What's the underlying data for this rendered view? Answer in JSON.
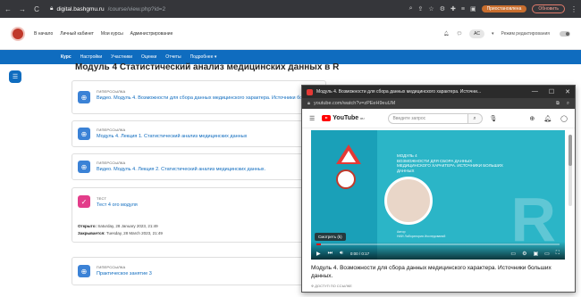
{
  "browser": {
    "url_host": "digital.bashgmu.ru",
    "url_path": "/course/view.php?id=2",
    "profile_label": "Приостановлена",
    "update_label": "Обновить"
  },
  "header": {
    "nav": [
      "В начало",
      "Личный кабинет",
      "Мои курсы",
      "Администрирование"
    ],
    "avatar": "АС",
    "edit_mode_label": "Режим редактирования"
  },
  "course_nav": [
    "Курс",
    "Настройки",
    "Участники",
    "Оценки",
    "Отчеты",
    "Подробнее ▾"
  ],
  "section_title": "Модуль 4 Статистический анализ медицинских данных в R",
  "activities": [
    {
      "type": "ГИПЕРССЫЛКА",
      "name": "Видео. Модуль 4. Возможности для сбора данных медицинского характера. Источники больших данных."
    },
    {
      "type": "ГИПЕРССЫЛКА",
      "name": "Модуль 4. Лекция 1. Статистический анализ медицинских данных"
    },
    {
      "type": "ГИПЕРССЫЛКА",
      "name": "Видео. Модуль 4. Лекция 2. Статистический анализ медицинских данных."
    },
    {
      "type": "ТЕСТ",
      "name": "Тест 4 ого модуля",
      "open_label": "Открыто:",
      "open_value": "Saturday, 28 January 2023, 21:49",
      "close_label": "Закрывается:",
      "close_value": "Tuesday, 28 March 2023, 21:49"
    },
    {
      "type": "ГИПЕРССЫЛКА",
      "name": "Практическое занятие 3"
    }
  ],
  "youtube": {
    "window_title": "Модуль 4. Возможности для сбора данных медицинского характера. Источни...",
    "url": "youtube.com/watch?v=zPEeH9euUM",
    "search_placeholder": "Введите запрос",
    "logo_text": "YouTube",
    "logo_sup": "RU",
    "slide_text": "МОДУЛЬ 4\nВОЗМОЖНОСТИ ДЛЯ СБОРА ДАННЫХ\nМЕДИЦИНСКОГО ХАРАКТЕРА. ИСТОЧНИКИ БОЛЬШИХ ДАННЫХ",
    "speaker": "Автор\nНИИ Лаборатория Исследований",
    "tooltip": "Смотреть (k)",
    "time": "0:00 / 0:17",
    "progress": 0.02,
    "video_title": "Модуль 4. Возможности для сбора данных медицинского характера. Источники больших данных.",
    "video_meta": "Ф ДОСТУП ПО ССЫЛКЕ"
  }
}
